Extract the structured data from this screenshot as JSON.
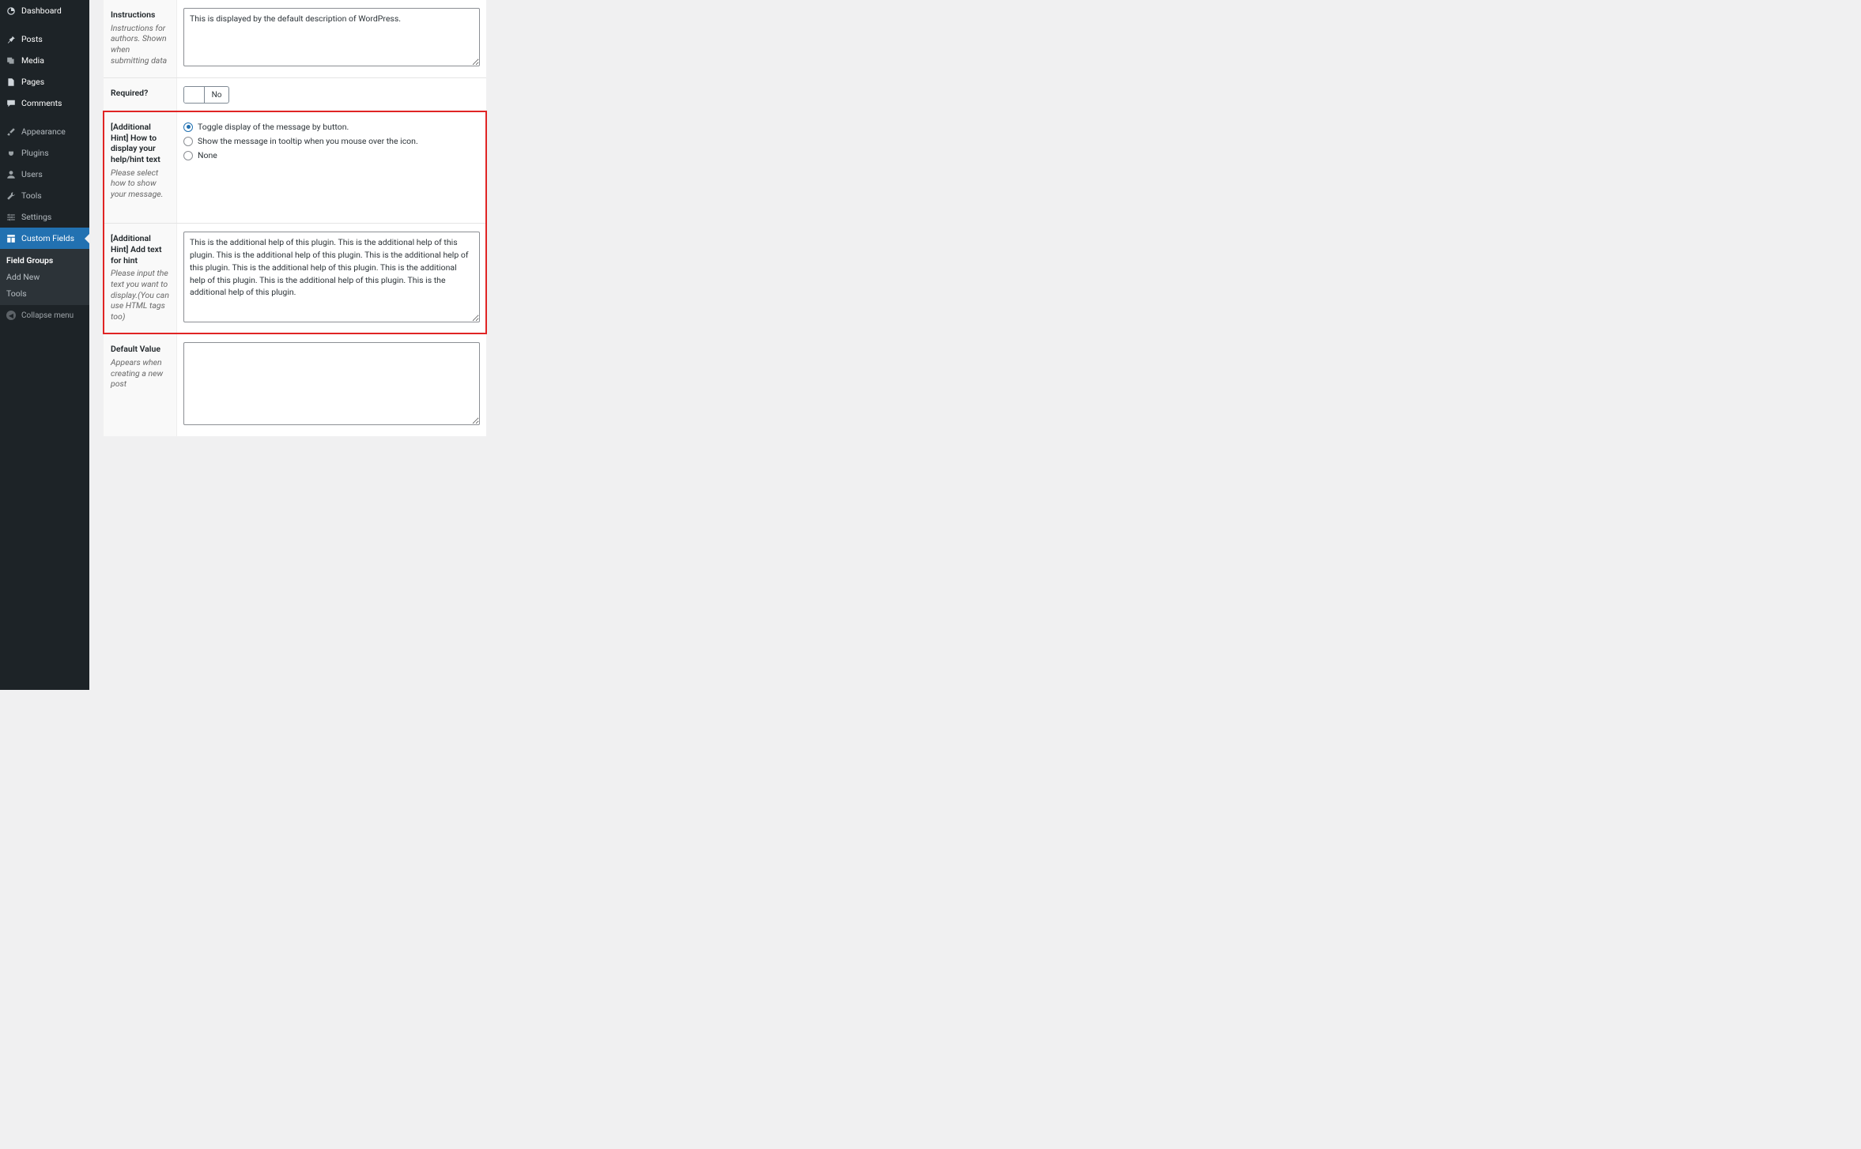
{
  "sidebar": {
    "items": [
      {
        "name": "dashboard",
        "label": "Dashboard",
        "icon": "dashboard",
        "top": true
      },
      {
        "name": "posts",
        "label": "Posts",
        "icon": "pin",
        "top": true
      },
      {
        "name": "media",
        "label": "Media",
        "icon": "media",
        "top": true
      },
      {
        "name": "pages",
        "label": "Pages",
        "icon": "page",
        "top": true
      },
      {
        "name": "comments",
        "label": "Comments",
        "icon": "comment",
        "top": true
      },
      {
        "name": "appearance",
        "label": "Appearance",
        "icon": "brush"
      },
      {
        "name": "plugins",
        "label": "Plugins",
        "icon": "plug"
      },
      {
        "name": "users",
        "label": "Users",
        "icon": "user"
      },
      {
        "name": "tools",
        "label": "Tools",
        "icon": "wrench"
      },
      {
        "name": "settings",
        "label": "Settings",
        "icon": "sliders"
      },
      {
        "name": "custom-fields",
        "label": "Custom Fields",
        "icon": "layout",
        "active": true
      }
    ],
    "submenu": [
      {
        "name": "field-groups",
        "label": "Field Groups",
        "current": true
      },
      {
        "name": "add-new",
        "label": "Add New"
      },
      {
        "name": "tools-sub",
        "label": "Tools"
      }
    ],
    "collapse": "Collapse menu"
  },
  "fields": {
    "instructions": {
      "title": "Instructions",
      "desc": "Instructions for authors. Shown when submitting data",
      "value": "This is displayed by the default description of WordPress."
    },
    "required": {
      "title": "Required?",
      "toggle": "No"
    },
    "hint_display": {
      "title": "[Additional Hint] How to display your help/hint text",
      "desc": "Please select how to show your message.",
      "options": [
        {
          "label": "Toggle display of the message by button.",
          "checked": true
        },
        {
          "label": "Show the message in tooltip when you mouse over the icon.",
          "checked": false
        },
        {
          "label": "None",
          "checked": false
        }
      ]
    },
    "hint_text": {
      "title": "[Additional Hint] Add text for hint",
      "desc": "Please input the text you want to display.(You can use HTML tags too)",
      "value": "This is the additional help of this plugin. This is the additional help of this plugin. This is the additional help of this plugin. This is the additional help of this plugin. This is the additional help of this plugin. This is the additional help of this plugin. This is the additional help of this plugin. This is the additional help of this plugin."
    },
    "default_value": {
      "title": "Default Value",
      "desc": "Appears when creating a new post",
      "value": ""
    }
  }
}
